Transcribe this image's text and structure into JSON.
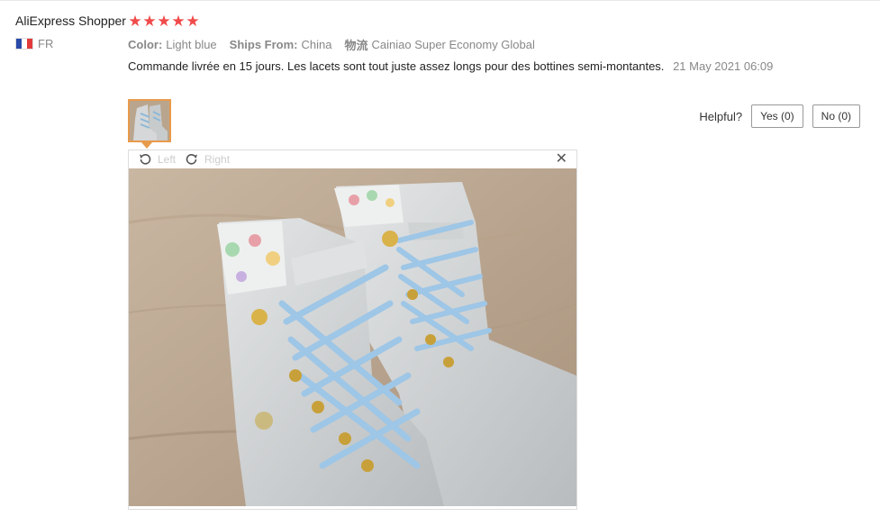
{
  "review": {
    "user": "AliExpress Shopper",
    "country_code": "FR",
    "country_flag_colors": [
      "#2a4aa8",
      "#ffffff",
      "#e23a3a"
    ],
    "rating_stars": 5,
    "star_color": "#f04a4a",
    "attributes": {
      "color_key": "Color:",
      "color_value": "Light blue",
      "ships_key": "Ships From:",
      "ships_value": "China",
      "logistics_key": "物流",
      "logistics_value": "Cainiao Super Economy Global"
    },
    "text": "Commande livrée en 15 jours. Les lacets sont tout juste assez longs pour des bottines semi-montantes.",
    "date": "21 May 2021 06:09"
  },
  "helpful": {
    "label": "Helpful?",
    "yes_label": "Yes (0)",
    "no_label": "No (0)"
  },
  "viewer": {
    "rotate_left_label": "Left",
    "rotate_right_label": "Right",
    "rotate_left_icon": "rotate-left-icon",
    "rotate_right_icon": "rotate-right-icon",
    "close_icon": "close-icon",
    "close_glyph": "✕"
  },
  "accent_color": "#e89a4b"
}
